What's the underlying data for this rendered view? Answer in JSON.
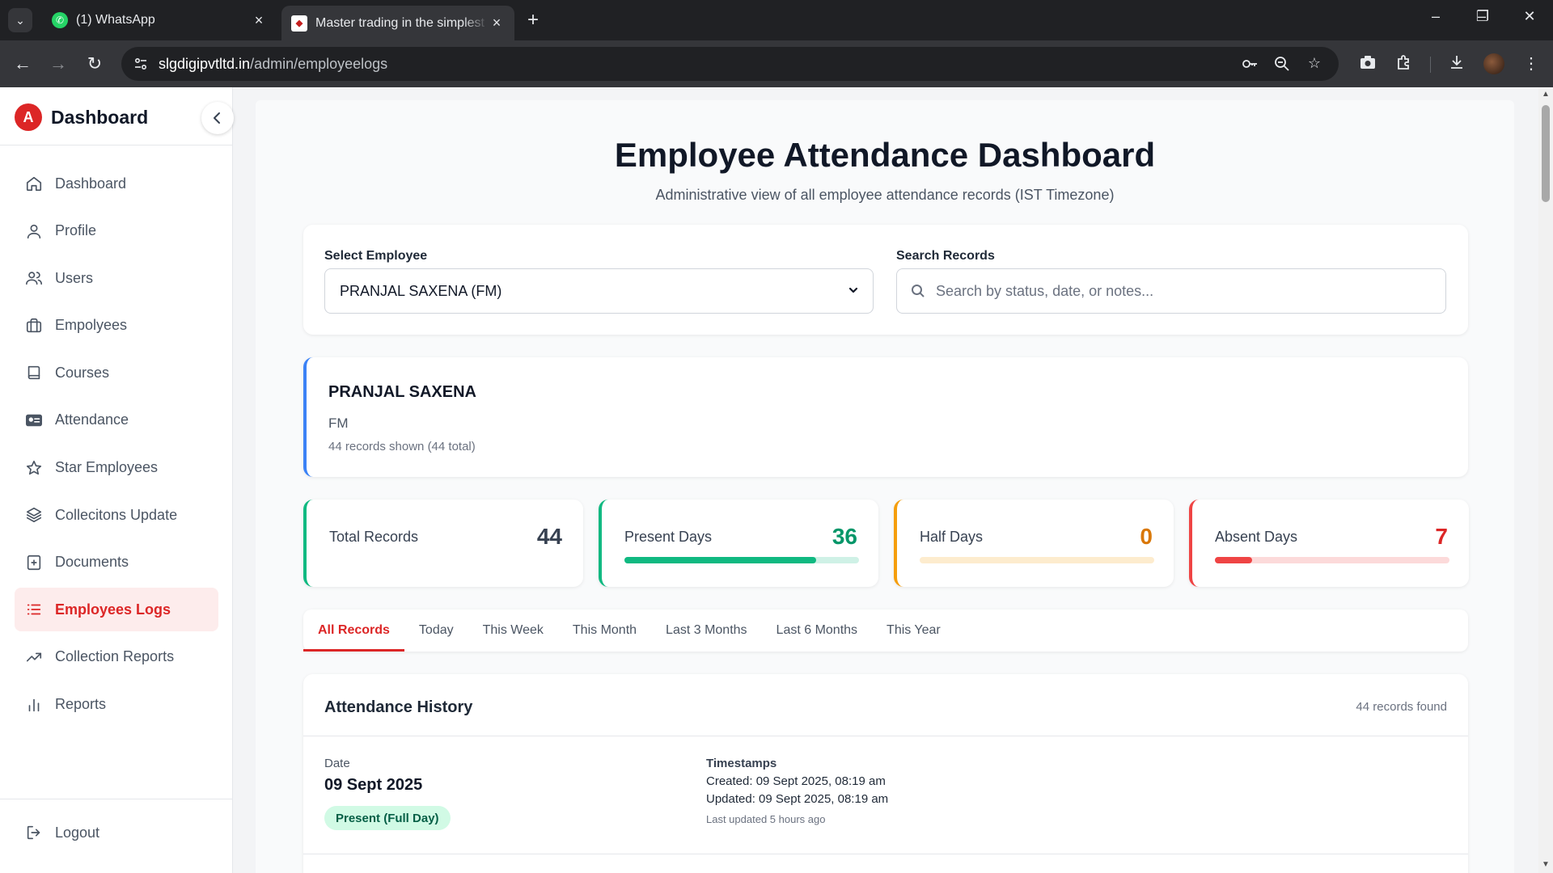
{
  "browser": {
    "tabs": [
      {
        "title": "(1) WhatsApp",
        "active": false
      },
      {
        "title": "Master trading in the simplest way",
        "active": true
      }
    ],
    "url_domain": "slgdigipvtltd.in",
    "url_path": "/admin/employeelogs"
  },
  "sidebar": {
    "logo_letter": "A",
    "title": "Dashboard",
    "items": [
      {
        "label": "Dashboard",
        "icon": "home-icon",
        "active": true
      },
      {
        "label": "Profile",
        "icon": "user-icon",
        "active": false
      },
      {
        "label": "Users",
        "icon": "users-icon",
        "active": false
      },
      {
        "label": "Empolyees",
        "icon": "briefcase-icon",
        "active": false
      },
      {
        "label": "Courses",
        "icon": "book-icon",
        "active": false
      },
      {
        "label": "Attendance",
        "icon": "id-card-icon",
        "active": false
      },
      {
        "label": "Star Employees",
        "icon": "star-icon",
        "active": false
      },
      {
        "label": "Collecitons Update",
        "icon": "layers-icon",
        "active": false
      },
      {
        "label": "Documents",
        "icon": "folder-plus-icon",
        "active": false
      },
      {
        "label": "Employees Logs",
        "icon": "list-icon",
        "active": true
      },
      {
        "label": "Collection Reports",
        "icon": "trending-up-icon",
        "active": false
      },
      {
        "label": "Reports",
        "icon": "bar-chart-icon",
        "active": false
      }
    ],
    "logout_label": "Logout"
  },
  "page": {
    "title": "Employee Attendance Dashboard",
    "subtitle": "Administrative view of all employee attendance records (IST Timezone)"
  },
  "filters": {
    "employee_label": "Select Employee",
    "employee_value": "PRANJAL SAXENA (FM)",
    "search_label": "Search Records",
    "search_placeholder": "Search by status, date, or notes..."
  },
  "employee": {
    "name": "PRANJAL SAXENA",
    "role": "FM",
    "records_text": "44 records shown (44 total)"
  },
  "stats": [
    {
      "label": "Total Records",
      "value": "44",
      "color": "#10b981",
      "value_color": "#374151",
      "progress": null
    },
    {
      "label": "Present Days",
      "value": "36",
      "color": "#10b981",
      "value_color": "#059669",
      "progress": 0.818
    },
    {
      "label": "Half Days",
      "value": "0",
      "color": "#f59e0b",
      "value_color": "#d97706",
      "progress": 0
    },
    {
      "label": "Absent Days",
      "value": "7",
      "color": "#ef4444",
      "value_color": "#dc2626",
      "progress": 0.159
    }
  ],
  "range_tabs": [
    {
      "label": "All Records",
      "active": true
    },
    {
      "label": "Today",
      "active": false
    },
    {
      "label": "This Week",
      "active": false
    },
    {
      "label": "This Month",
      "active": false
    },
    {
      "label": "Last 3 Months",
      "active": false
    },
    {
      "label": "Last 6 Months",
      "active": false
    },
    {
      "label": "This Year",
      "active": false
    }
  ],
  "history": {
    "title": "Attendance History",
    "count_text": "44 records found",
    "records": [
      {
        "date_label": "Date",
        "date": "09 Sept 2025",
        "status": "Present (Full Day)",
        "timestamps_label": "Timestamps",
        "created": "Created: 09 Sept 2025, 08:19 am",
        "updated": "Updated: 09 Sept 2025, 08:19 am",
        "last_updated": "Last updated 5 hours ago"
      }
    ]
  },
  "colors": {
    "accent": "#dc2626",
    "accent_bg": "#fdecec",
    "employee_border": "#3b82f6"
  }
}
